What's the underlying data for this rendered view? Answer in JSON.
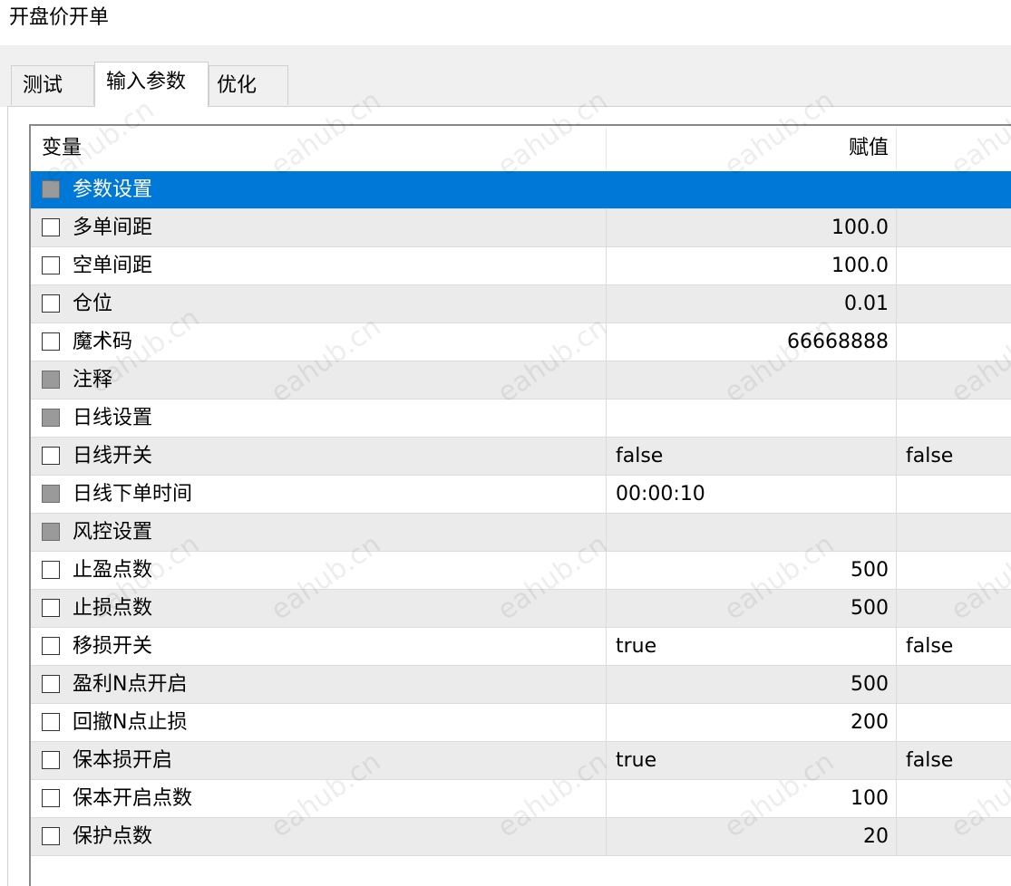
{
  "window": {
    "title": "开盘价开单"
  },
  "tabs": [
    {
      "label": "测试",
      "active": false
    },
    {
      "label": "输入参数",
      "active": true
    },
    {
      "label": "优化",
      "active": false
    }
  ],
  "table": {
    "headers": {
      "variable": "变量",
      "value": "赋值",
      "extra": ""
    },
    "rows": [
      {
        "name": "参数设置",
        "value": "",
        "extra": "",
        "checkbox": "group",
        "selected": true
      },
      {
        "name": "多单间距",
        "value": "100.0",
        "extra": "",
        "checkbox": "unchecked"
      },
      {
        "name": "空单间距",
        "value": "100.0",
        "extra": "",
        "checkbox": "unchecked"
      },
      {
        "name": "仓位",
        "value": "0.01",
        "extra": "",
        "checkbox": "unchecked"
      },
      {
        "name": "魔术码",
        "value": "66668888",
        "extra": "",
        "checkbox": "unchecked"
      },
      {
        "name": "注释",
        "value": "",
        "extra": "",
        "checkbox": "group"
      },
      {
        "name": "日线设置",
        "value": "",
        "extra": "",
        "checkbox": "group"
      },
      {
        "name": "日线开关",
        "value": "false",
        "extra": "false",
        "checkbox": "unchecked"
      },
      {
        "name": "日线下单时间",
        "value": "00:00:10",
        "extra": "",
        "checkbox": "group"
      },
      {
        "name": "风控设置",
        "value": "",
        "extra": "",
        "checkbox": "group"
      },
      {
        "name": "止盈点数",
        "value": "500",
        "extra": "",
        "checkbox": "unchecked"
      },
      {
        "name": "止损点数",
        "value": "500",
        "extra": "",
        "checkbox": "unchecked"
      },
      {
        "name": "移损开关",
        "value": "true",
        "extra": "false",
        "checkbox": "unchecked"
      },
      {
        "name": "盈利N点开启",
        "value": "500",
        "extra": "",
        "checkbox": "unchecked"
      },
      {
        "name": "回撤N点止损",
        "value": "200",
        "extra": "",
        "checkbox": "unchecked"
      },
      {
        "name": "保本损开启",
        "value": "true",
        "extra": "false",
        "checkbox": "unchecked"
      },
      {
        "name": "保本开启点数",
        "value": "100",
        "extra": "",
        "checkbox": "unchecked"
      },
      {
        "name": "保护点数",
        "value": "20",
        "extra": "",
        "checkbox": "unchecked"
      }
    ]
  },
  "watermark": {
    "text": "eahub.cn"
  },
  "colors": {
    "selection": "#0078d7",
    "alt_row": "#ebebeb",
    "checkbox_group": "#9a9a9a"
  }
}
